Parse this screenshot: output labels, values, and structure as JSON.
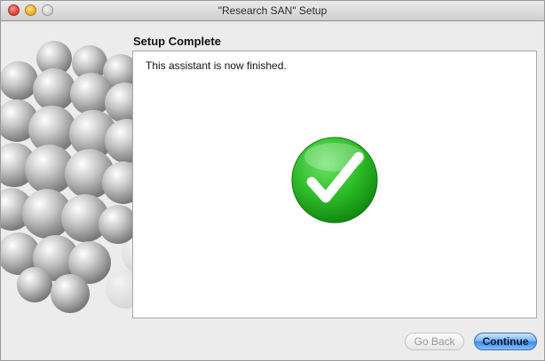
{
  "window": {
    "title": "\"Research SAN\" Setup"
  },
  "page": {
    "heading": "Setup Complete",
    "message": "This assistant is now finished."
  },
  "buttons": {
    "back_label": "Go Back",
    "continue_label": "Continue"
  },
  "colors": {
    "check_green": "#2fbe2a",
    "continue_blue": "#4a93ee"
  }
}
